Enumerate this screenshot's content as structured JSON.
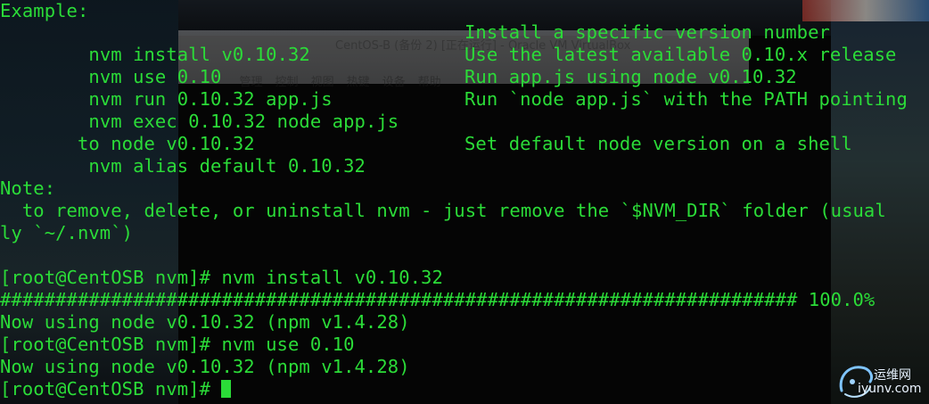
{
  "background": {
    "vm_window_title": "CentOS-B (备份 2) [正在运行] - Oracle VM VirtualBox",
    "vm_menu": [
      "管理",
      "控制",
      "视图",
      "热键",
      "设备",
      "帮助"
    ]
  },
  "terminal": {
    "example_header": "Example:",
    "examples": [
      {
        "cmd": "  nvm install v0.10.32",
        "desc": "Install a specific version number"
      },
      {
        "cmd": "  nvm use 0.10",
        "desc": "Use the latest available 0.10.x release"
      },
      {
        "cmd": "  nvm run 0.10.32 app.js",
        "desc": "Run app.js using node v0.10.32"
      },
      {
        "cmd": "  nvm exec 0.10.32 node app.js",
        "desc": "Run `node app.js` with the PATH pointing"
      },
      {
        "cmd": " to node v0.10.32",
        "desc": ""
      },
      {
        "cmd": "  nvm alias default 0.10.32",
        "desc": "Set default node version on a shell"
      }
    ],
    "blank_1": "",
    "note_header": "Note:",
    "note_line_1": "  to remove, delete, or uninstall nvm - just remove the `$NVM_DIR` folder (usual",
    "note_line_2": "ly `~/.nvm`)",
    "blank_2": "",
    "prompt_1": "[root@CentOSB nvm]# nvm install v0.10.32",
    "progress_line": "######################################################################## 100.0%",
    "output_1": "Now using node v0.10.32 (npm v1.4.28)",
    "prompt_2": "[root@CentOSB nvm]# nvm use 0.10",
    "output_2": "Now using node v0.10.32 (npm v1.4.28)",
    "prompt_3": "[root@CentOSB nvm]# "
  },
  "watermark": {
    "site_name": "运维网",
    "site_url": "iyunv.com"
  },
  "colors": {
    "terminal_text": "#2bdc38",
    "terminal_bg": "#050505"
  }
}
